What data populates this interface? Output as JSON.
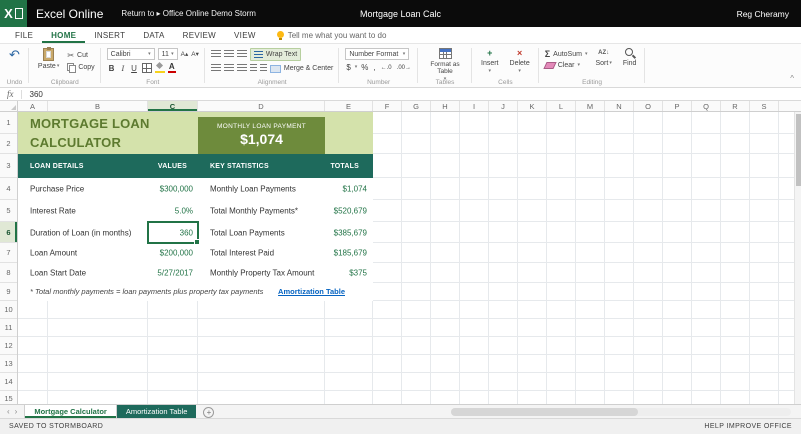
{
  "colors": {
    "accent_green": "#217346",
    "light_green_fill": "#d4e2ab",
    "title_text": "#5d7a2f",
    "olive_box": "#6e8b3c",
    "teal_header": "#1e6a5c",
    "value_text": "#217346",
    "link_blue": "#0563c1",
    "topbar_black": "#0b0b0b"
  },
  "icons": {
    "excel_x": "X",
    "caret": "▾",
    "undo": "↶",
    "cut": "✂",
    "grow_font": "A▴",
    "shrink_font": "A▾",
    "font_color_a": "A",
    "sigma": "Σ",
    "sort_az": "AZ↓",
    "plus": "+",
    "cross": "×",
    "collapse": "^",
    "prev": "‹",
    "next": "›",
    "add_sheet": "+"
  },
  "topbar": {
    "brand": "Excel Online",
    "return_link": "Return to ▸ Office Online Demo Storm",
    "doc_title": "Mortgage Loan Calc",
    "user_name": "Reg Cheramy"
  },
  "ribbon_tabs": [
    {
      "label": "FILE",
      "active": false
    },
    {
      "label": "HOME",
      "active": true
    },
    {
      "label": "INSERT",
      "active": false
    },
    {
      "label": "DATA",
      "active": false
    },
    {
      "label": "REVIEW",
      "active": false
    },
    {
      "label": "VIEW",
      "active": false
    }
  ],
  "tell_me": "Tell me what you want to do",
  "ribbon": {
    "undo": {
      "label": "Undo"
    },
    "clipboard": {
      "group": "Clipboard",
      "paste": "Paste",
      "cut": "Cut",
      "copy": "Copy"
    },
    "font": {
      "group": "Font",
      "font_name": "Calibri",
      "font_size": "11",
      "bold": "B",
      "italic": "I",
      "underline": "U"
    },
    "alignment": {
      "group": "Alignment",
      "wrap_text": "Wrap Text",
      "merge_center": "Merge & Center"
    },
    "number": {
      "group": "Number",
      "number_format": "Number Format",
      "currency": "$",
      "percent": "%",
      "comma": ",",
      "increase_decimal": "←.0",
      "decrease_decimal": ".00→"
    },
    "tables": {
      "group": "Tables",
      "format_as_table": "Format as Table"
    },
    "cells": {
      "group": "Cells",
      "insert": "Insert",
      "delete": "Delete"
    },
    "editing": {
      "group": "Editing",
      "autosum": "AutoSum",
      "clear": "Clear",
      "sort": "Sort",
      "find": "Find"
    }
  },
  "formula_bar": {
    "fx": "fx",
    "value": "360"
  },
  "grid": {
    "columns": [
      "A",
      "B",
      "C",
      "D",
      "E",
      "F",
      "G",
      "H",
      "I",
      "J",
      "K",
      "L",
      "M",
      "N",
      "O",
      "P",
      "Q",
      "R",
      "S"
    ],
    "selected_column": "C",
    "rows": [
      "1",
      "2",
      "3",
      "4",
      "5",
      "6",
      "7",
      "8",
      "9",
      "10",
      "11",
      "12",
      "13",
      "14",
      "15"
    ],
    "selected_row": "6"
  },
  "worksheet": {
    "title": "MORTGAGE LOAN CALCULATOR",
    "payment_label": "MONTHLY LOAN PAYMENT",
    "payment_value": "$1,074",
    "columns": {
      "details": "LOAN DETAILS",
      "values": "VALUES",
      "stats": "KEY STATISTICS",
      "totals": "TOTALS"
    },
    "rows": [
      {
        "label": "Purchase Price",
        "value": "$300,000",
        "stat": "Monthly Loan Payments",
        "total": "$1,074"
      },
      {
        "label": "Interest Rate",
        "value": "5.0%",
        "stat": "Total Monthly Payments*",
        "total": "$520,679"
      },
      {
        "label": "Duration of Loan (in months)",
        "value": "360",
        "stat": "Total Loan Payments",
        "total": "$385,679"
      },
      {
        "label": "Loan Amount",
        "value": "$200,000",
        "stat": "Total Interest Paid",
        "total": "$185,679"
      },
      {
        "label": "Loan Start Date",
        "value": "5/27/2017",
        "stat": "Monthly Property Tax Amount",
        "total": "$375"
      }
    ],
    "footnote": "* Total monthly payments = loan payments plus property tax payments",
    "amortization_link": "Amortization Table"
  },
  "sheet_tabs": [
    {
      "label": "Mortgage Calculator",
      "active": true
    },
    {
      "label": "Amortization Table",
      "active": false
    }
  ],
  "status_bar": {
    "left": "SAVED TO STORMBOARD",
    "right": "HELP IMPROVE OFFICE"
  }
}
